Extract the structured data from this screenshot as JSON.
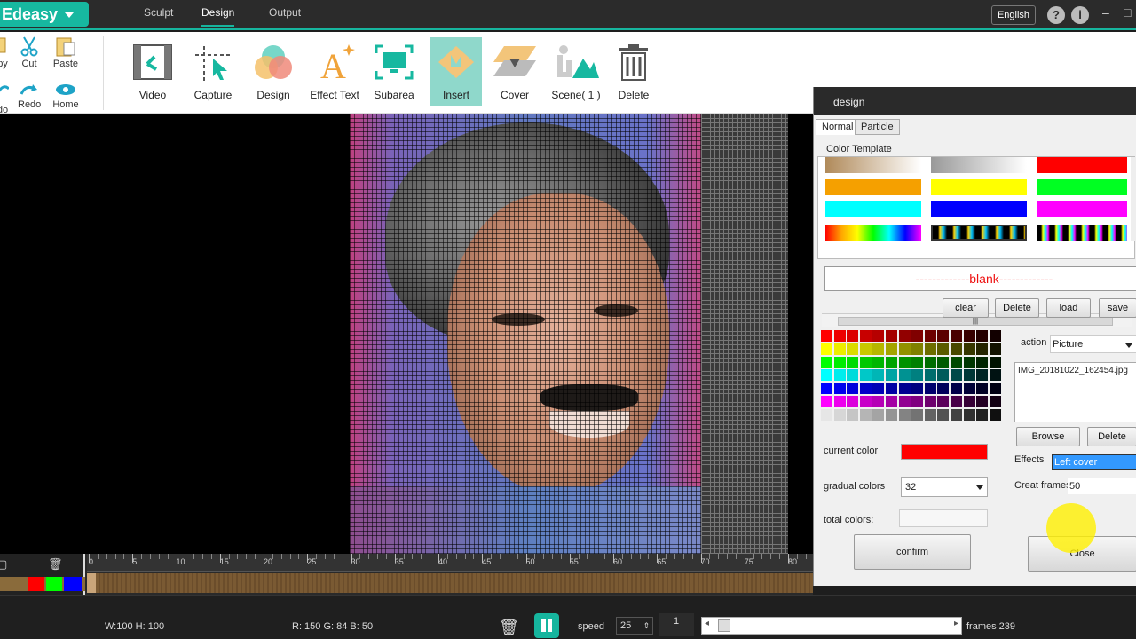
{
  "app": {
    "logo": "Edeasy",
    "language": "English"
  },
  "top_tabs": [
    {
      "label": "Sculpt"
    },
    {
      "label": "Design"
    },
    {
      "label": "Output"
    }
  ],
  "toolbar": {
    "small": [
      {
        "label": "py"
      },
      {
        "label": "Cut"
      },
      {
        "label": "Paste"
      },
      {
        "label": "do"
      },
      {
        "label": "Redo"
      },
      {
        "label": "Home"
      }
    ],
    "buttons": [
      {
        "label": "Video"
      },
      {
        "label": "Capture"
      },
      {
        "label": "Design"
      },
      {
        "label": "Effect Text"
      },
      {
        "label": "Subarea"
      },
      {
        "label": "Insert"
      },
      {
        "label": "Cover"
      },
      {
        "label": "Scene( 1 )"
      },
      {
        "label": "Delete"
      }
    ]
  },
  "timeline": {
    "ticks": [
      "0",
      "5",
      "10",
      "15",
      "20",
      "25",
      "30",
      "35",
      "40",
      "45",
      "50",
      "55",
      "60",
      "65",
      "70",
      "75",
      "80"
    ]
  },
  "status": {
    "size": "W:100 H: 100",
    "rgb": "R: 150 G: 84 B: 50",
    "speed_label": "speed",
    "speed_value": "25",
    "frame_value": "1",
    "frames": "frames 239"
  },
  "dialog": {
    "title": "design",
    "tabs": [
      {
        "label": "Normal"
      },
      {
        "label": "Particle"
      }
    ],
    "color_template_label": "Color Template",
    "blank_text": "-------------blank-------------",
    "buttons": {
      "clear": "clear",
      "delete": "Delete",
      "load": "load",
      "save": "save",
      "browse": "Browse",
      "delete2": "Delete",
      "confirm": "confirm",
      "close": "Close"
    },
    "current_color_label": "current color",
    "current_color": "#ff0000",
    "gradual_colors_label": "gradual colors",
    "gradual_colors_value": "32",
    "total_colors_label": "total colors:",
    "action_label": "action",
    "action_value": "Picture",
    "file_name": "IMG_20181022_162454.jpg",
    "effects_label": "Effects",
    "effects_value": "Left cover",
    "creat_frames_label": "Creat frames",
    "creat_frames_value": "50"
  },
  "colors": {
    "accent": "#16b59e"
  }
}
